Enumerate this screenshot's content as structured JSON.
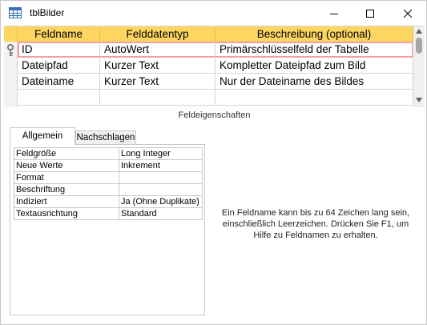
{
  "window": {
    "title": "tblBilder"
  },
  "grid": {
    "headers": [
      "Feldname",
      "Felddatentyp",
      "Beschreibung (optional)"
    ],
    "rows": [
      {
        "name": "ID",
        "type": "AutoWert",
        "description": "Primärschlüsselfeld der Tabelle"
      },
      {
        "name": "Dateipfad",
        "type": "Kurzer Text",
        "description": "Kompletter Dateipfad zum Bild"
      },
      {
        "name": "Dateiname",
        "type": "Kurzer Text",
        "description": "Nur der Dateiname des Bildes"
      }
    ]
  },
  "section_label": "Feldeigenschaften",
  "tabs": {
    "general": "Allgemein",
    "lookup": "Nachschlagen"
  },
  "properties": [
    {
      "name": "Feldgröße",
      "value": "Long Integer"
    },
    {
      "name": "Neue Werte",
      "value": "Inkrement"
    },
    {
      "name": "Format",
      "value": ""
    },
    {
      "name": "Beschriftung",
      "value": ""
    },
    {
      "name": "Indiziert",
      "value": "Ja (Ohne Duplikate)"
    },
    {
      "name": "Textausrichtung",
      "value": "Standard"
    }
  ],
  "help_text": "Ein Feldname kann bis zu 64 Zeichen lang sein, einschließlich Leerzeichen. Drücken Sie F1, um Hilfe zu Feldnamen zu erhalten.",
  "colors": {
    "header": "#fdd662",
    "selected_outline": "#f0a0a0"
  },
  "icons": {
    "app": "table-icon",
    "key": "primary-key-icon",
    "minimize": "minimize-icon",
    "maximize": "maximize-icon",
    "close": "close-icon"
  }
}
